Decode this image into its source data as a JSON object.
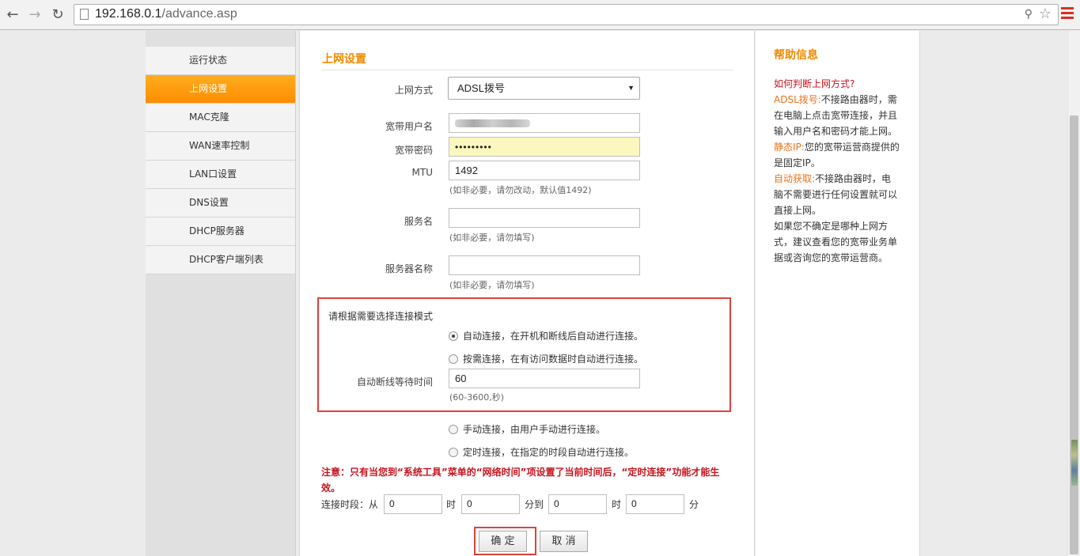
{
  "browser": {
    "url_host": "192.168.0.1",
    "url_path": "/advance.asp"
  },
  "sidebar": {
    "items": [
      {
        "label": "运行状态",
        "active": false
      },
      {
        "label": "上网设置",
        "active": true
      },
      {
        "label": "MAC克隆",
        "active": false
      },
      {
        "label": "WAN速率控制",
        "active": false
      },
      {
        "label": "LAN口设置",
        "active": false
      },
      {
        "label": "DNS设置",
        "active": false
      },
      {
        "label": "DHCP服务器",
        "active": false
      },
      {
        "label": "DHCP客户端列表",
        "active": false
      }
    ]
  },
  "form": {
    "title": "上网设置",
    "wan_type_label": "上网方式",
    "wan_type_value": "ADSL拨号",
    "username_label": "宽带用户名",
    "password_label": "宽带密码",
    "password_value": "•••••••••",
    "mtu_label": "MTU",
    "mtu_value": "1492",
    "mtu_hint": "(如非必要，请勿改动，默认值1492)",
    "service_label": "服务名",
    "service_value": "",
    "service_hint": "(如非必要，请勿填写)",
    "server_label": "服务器名称",
    "server_value": "",
    "server_hint": "(如非必要，请勿填写)",
    "mode_title": "请根据需要选择连接模式",
    "mode_auto": "自动连接，在开机和断线后自动进行连接。",
    "mode_demand": "按需连接，在有访问数据时自动进行连接。",
    "idle_label": "自动断线等待时间",
    "idle_value": "60",
    "idle_hint": "(60-3600,秒)",
    "mode_manual": "手动连接，由用户手动进行连接。",
    "mode_timed": "定时连接，在指定的时段自动进行连接。",
    "note": "注意：只有当您到“系统工具”菜单的“网络时间”项设置了当前时间后，“定时连接”功能才能生效。",
    "period_label": "连接时段：从",
    "hour_unit": "时",
    "minute_to": "分到",
    "minute_unit": "分",
    "start_hour": "0",
    "start_minute": "0",
    "end_hour": "0",
    "end_minute": "0",
    "ok_label": "确 定",
    "cancel_label": "取 消"
  },
  "help": {
    "title": "帮助信息",
    "question": "如何判断上网方式?",
    "adsl_key": "ADSL拨号:",
    "adsl_text": "不接路由器时，需在电脑上点击宽带连接，并且输入用户名和密码才能上网。",
    "static_key": "静态IP:",
    "static_text": "您的宽带运营商提供的是固定IP。",
    "dhcp_key": "自动获取:",
    "dhcp_text": "不接路由器时，电脑不需要进行任何设置就可以直接上网。",
    "unsure_text": "如果您不确定是哪种上网方式，建议查看您的宽带业务单据或咨询您的宽带运营商。"
  }
}
